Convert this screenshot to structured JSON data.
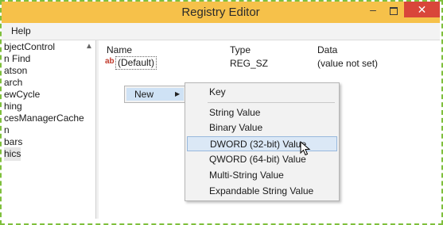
{
  "window": {
    "title": "Registry Editor",
    "controls": {
      "minimize": "–",
      "close": "✕"
    }
  },
  "menubar": {
    "help": "Help"
  },
  "tree": {
    "items": [
      "bjectControl",
      "n Find",
      "atson",
      "arch",
      "ewCycle",
      "hing",
      "cesManagerCache",
      "n",
      "bars",
      "hics"
    ],
    "selected_index": 9
  },
  "list": {
    "columns": [
      "Name",
      "Type",
      "Data"
    ],
    "rows": [
      {
        "icon": "ab",
        "name": "(Default)",
        "type": "REG_SZ",
        "data": "(value not set)"
      }
    ]
  },
  "context_menu": {
    "new_label": "New"
  },
  "submenu": {
    "items": [
      "Key",
      "String Value",
      "Binary Value",
      "DWORD (32-bit) Value",
      "QWORD (64-bit) Value",
      "Multi-String Value",
      "Expandable String Value"
    ],
    "highlighted": "DWORD (32-bit) Value"
  },
  "colors": {
    "titlebar": "#f6c14a",
    "close_button": "#d9463a",
    "highlight": "#dbe8f6",
    "frame_dashes": "#7fbf3c"
  }
}
